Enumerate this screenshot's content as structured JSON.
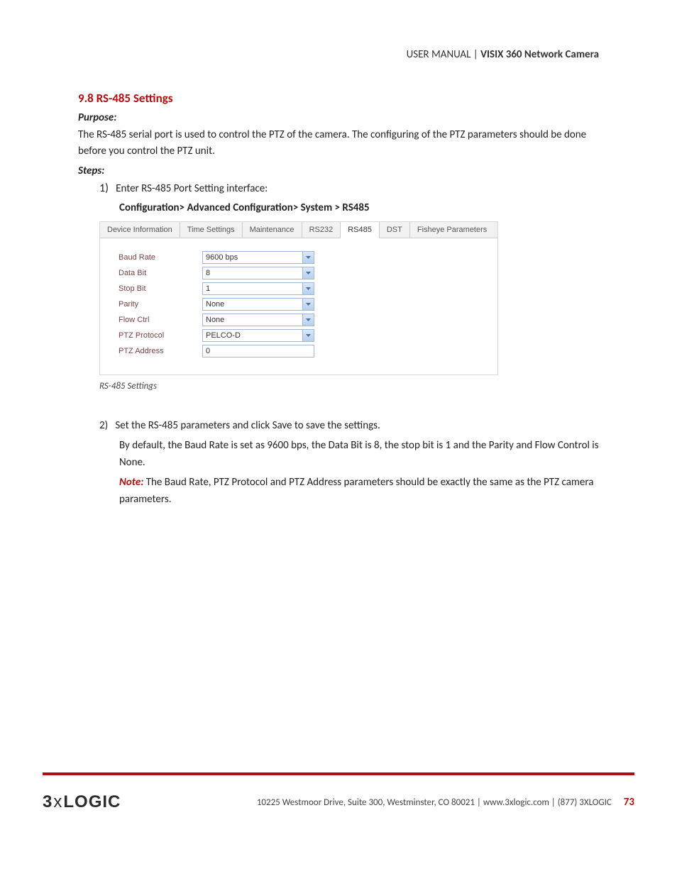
{
  "header": {
    "prefix": "USER MANUAL | ",
    "title": "VISIX 360 Network Camera"
  },
  "section": {
    "number_title": "9.8 RS-485 Settings",
    "purpose_label": "Purpose:",
    "purpose_text": "The RS-485 serial port is used to control the PTZ of the camera. The configuring of the PTZ parameters should be done before you control the PTZ unit.",
    "steps_label": "Steps:",
    "step1_num": "1)",
    "step1_text": "Enter RS-485 Port Setting interface:",
    "config_path": "Configuration> Advanced Configuration> System > RS485"
  },
  "tabs": [
    "Device Information",
    "Time Settings",
    "Maintenance",
    "RS232",
    "RS485",
    "DST",
    "Fisheye Parameters"
  ],
  "form": {
    "baud_rate": {
      "label": "Baud Rate",
      "value": "9600 bps"
    },
    "data_bit": {
      "label": "Data Bit",
      "value": "8"
    },
    "stop_bit": {
      "label": "Stop Bit",
      "value": "1"
    },
    "parity": {
      "label": "Parity",
      "value": "None"
    },
    "flow_ctrl": {
      "label": "Flow Ctrl",
      "value": "None"
    },
    "ptz_protocol": {
      "label": "PTZ Protocol",
      "value": "PELCO-D"
    },
    "ptz_address": {
      "label": "PTZ Address",
      "value": "0"
    }
  },
  "caption": "RS-485 Settings",
  "step2": {
    "num": "2)",
    "line1": "Set the RS-485 parameters and click Save to save the settings.",
    "line2": "By default, the Baud Rate is set as 9600 bps, the Data Bit is 8, the stop bit is 1 and the Parity and Flow Control is None.",
    "note_label": "Note:",
    "note_text": " The Baud Rate, PTZ Protocol and PTZ Address parameters should be exactly the same as the PTZ camera parameters."
  },
  "footer": {
    "logo_a": "3",
    "logo_x": "x",
    "logo_b": "LOGIC",
    "text": "10225 Westmoor Drive, Suite 300, Westminster, CO 80021 | www.3xlogic.com | (877) 3XLOGIC",
    "page": "73"
  }
}
